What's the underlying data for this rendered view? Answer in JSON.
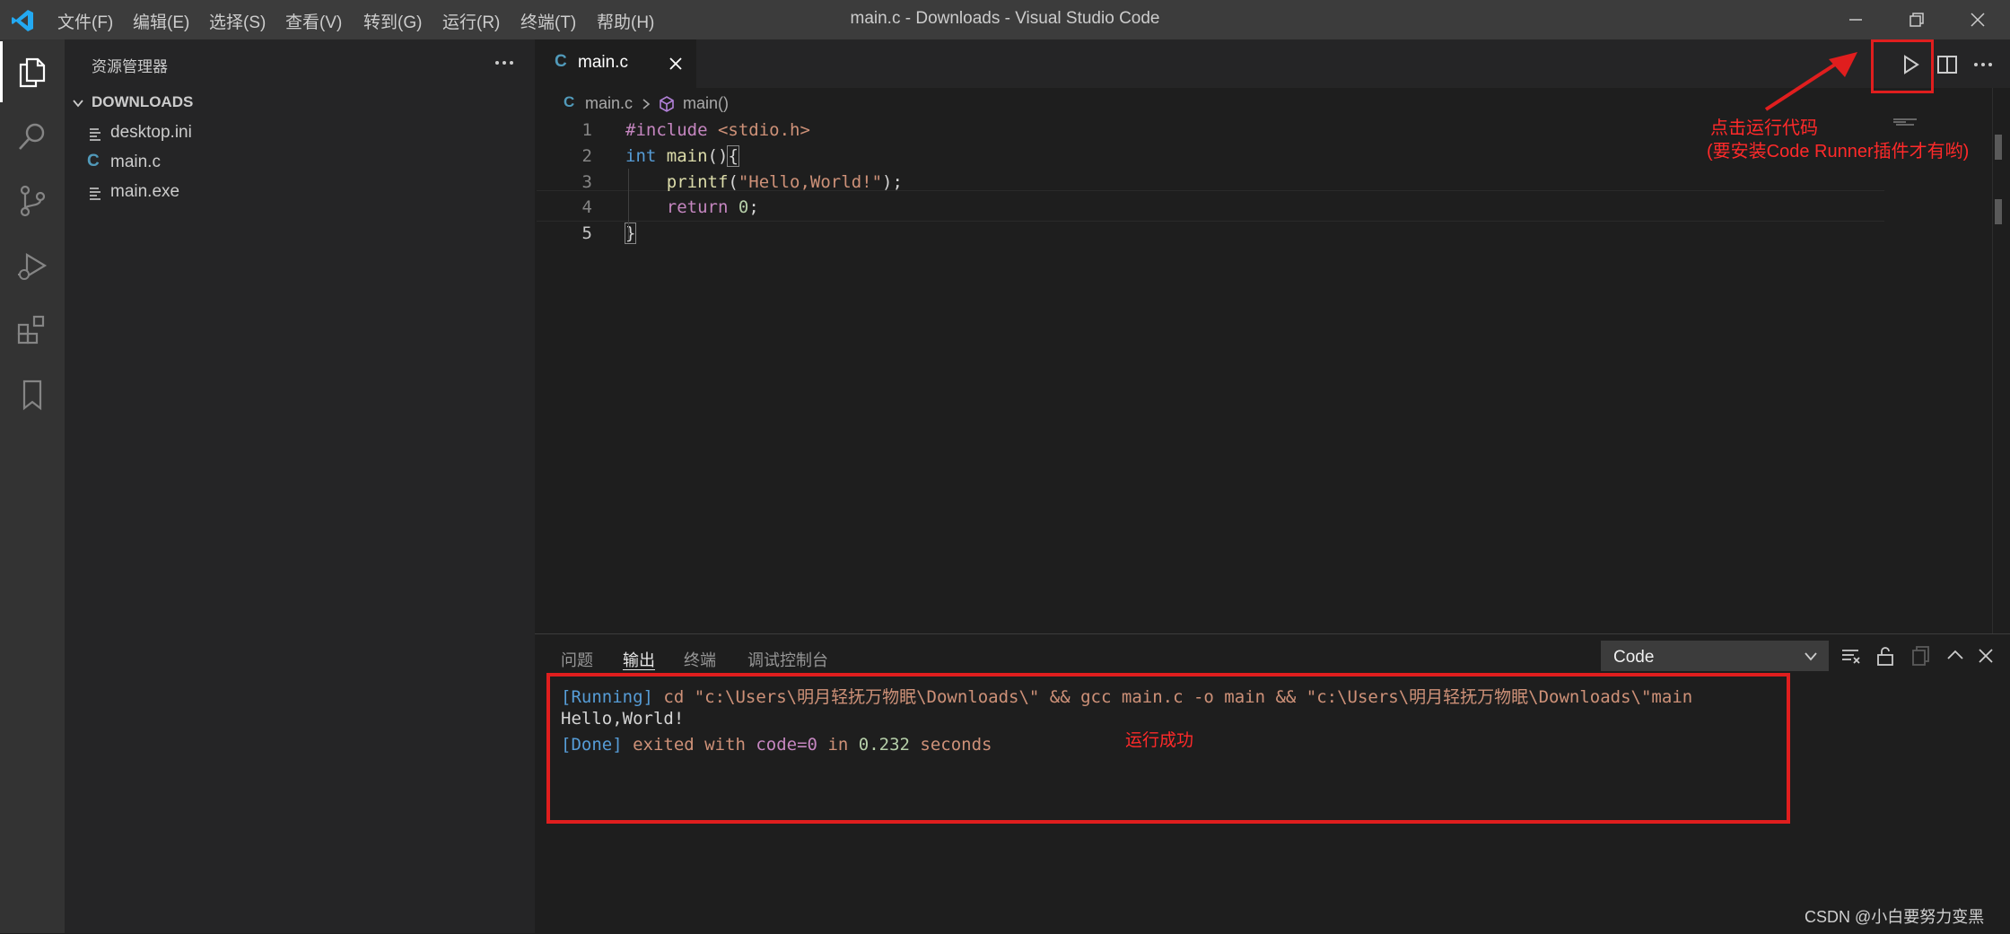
{
  "titlebar": {
    "menus": [
      "文件(F)",
      "编辑(E)",
      "选择(S)",
      "查看(V)",
      "转到(G)",
      "运行(R)",
      "终端(T)",
      "帮助(H)"
    ],
    "title": "main.c - Downloads - Visual Studio Code"
  },
  "sidebar": {
    "header": "资源管理器",
    "folder": "DOWNLOADS",
    "files": [
      {
        "name": "desktop.ini",
        "icon": "file-lines-icon"
      },
      {
        "name": "main.c",
        "icon": "c-file-icon",
        "icon_text": "C"
      },
      {
        "name": "main.exe",
        "icon": "file-lines-icon"
      }
    ]
  },
  "editor": {
    "tab_label": "main.c",
    "tab_icon_text": "C",
    "breadcrumb": {
      "file": "main.c",
      "symbol": "main()"
    },
    "line_numbers": [
      "1",
      "2",
      "3",
      "4",
      "5"
    ],
    "code": {
      "l1_directive": "#include",
      "l1_header": " <stdio.h>",
      "l2_type": "int",
      "l2_func": "main",
      "l2_rest": "()",
      "l2_brace": "{",
      "l3_indent": "    ",
      "l3_func": "printf",
      "l3_open": "(",
      "l3_string": "\"Hello,World!\"",
      "l3_close": ");",
      "l4_indent": "    ",
      "l4_keyword": "return",
      "l4_space": " ",
      "l4_number": "0",
      "l4_semi": ";",
      "l5_brace": "}"
    }
  },
  "annotations": {
    "run_hint_line1": "点击运行代码",
    "run_hint_line2": "(要安装Code Runner插件才有哟)",
    "success": "运行成功",
    "color": "#ff2a2a"
  },
  "panel": {
    "tabs": [
      "问题",
      "输出",
      "终端",
      "调试控制台"
    ],
    "active_tab": "输出",
    "dropdown_value": "Code",
    "output": {
      "l1_tag": "[Running]",
      "l1_cmd": " cd \"c:\\Users\\明月轻抚万物眠\\Downloads\\\" && gcc main.c -o main && \"c:\\Users\\明月轻抚万物眠\\Downloads\\\"main",
      "l2": "Hello,World!",
      "l3_tag": "[Done]",
      "l3_a": " exited with ",
      "l3_code": "code=0",
      "l3_b": " in ",
      "l3_num": "0.232",
      "l3_c": " seconds"
    }
  },
  "watermark": "CSDN @小白要努力变黑"
}
